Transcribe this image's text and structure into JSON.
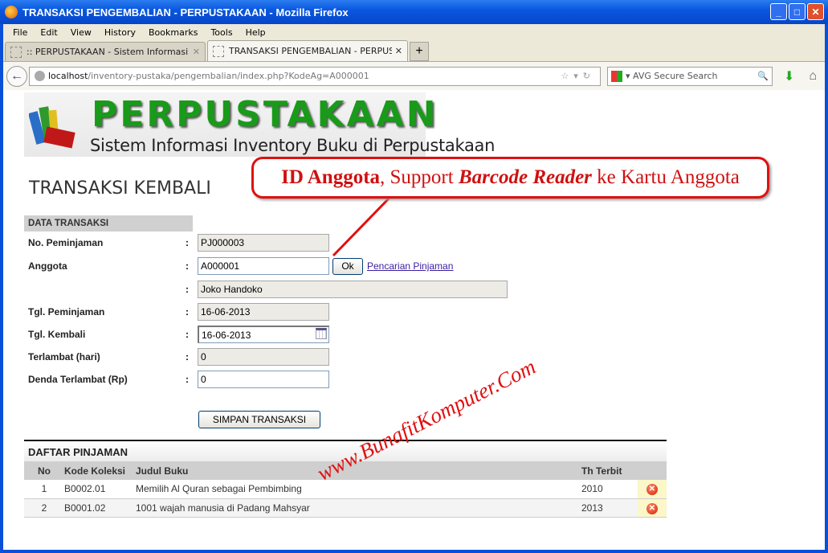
{
  "window": {
    "title": "TRANSAKSI PENGEMBALIAN - PERPUSTAKAAN - Mozilla Firefox"
  },
  "menu": [
    "File",
    "Edit",
    "View",
    "History",
    "Bookmarks",
    "Tools",
    "Help"
  ],
  "tabs": [
    {
      "label": ":: PERPUSTAKAAN - Sistem Informasi Inv..."
    },
    {
      "label": "TRANSAKSI PENGEMBALIAN - PERPUSTA..."
    }
  ],
  "url": {
    "host": "localhost",
    "path": "/inventory-pustaka/pengembalian/index.php?KodeAg=A000001"
  },
  "search": {
    "placeholder": "AVG Secure Search"
  },
  "logo": {
    "title": "PERPUSTAKAAN",
    "subtitle": "Sistem Informasi Inventory Buku di Perpustakaan"
  },
  "page_title": "TRANSAKSI KEMBALI",
  "callout": {
    "bold": "ID Anggota",
    "mid": ", Support ",
    "italic": "Barcode Reader",
    "end": " ke Kartu Anggota"
  },
  "form": {
    "section": "DATA TRANSAKSI",
    "colon": ":",
    "no_peminjaman": {
      "label": "No. Peminjaman",
      "value": "PJ000003"
    },
    "anggota": {
      "label": "Anggota",
      "value": "A000001",
      "ok": "Ok",
      "link": "Pencarian Pinjaman",
      "name": "Joko Handoko"
    },
    "tgl_peminjaman": {
      "label": "Tgl. Peminjaman",
      "value": "16-06-2013"
    },
    "tgl_kembali": {
      "label": "Tgl. Kembali",
      "value": "16-06-2013"
    },
    "terlambat": {
      "label": "Terlambat (hari)",
      "value": "0"
    },
    "denda": {
      "label": "Denda Terlambat (Rp)",
      "value": "0"
    },
    "save": "SIMPAN TRANSAKSI"
  },
  "table": {
    "title": "DAFTAR PINJAMAN",
    "headers": [
      "No",
      "Kode Koleksi",
      "Judul Buku",
      "Th Terbit"
    ],
    "rows": [
      {
        "no": "1",
        "kode": "B0002.01",
        "judul": "Memilih Al Quran sebagai Pembimbing",
        "tahun": "2010"
      },
      {
        "no": "2",
        "kode": "B0001.02",
        "judul": "1001 wajah manusia di Padang Mahsyar",
        "tahun": "2013"
      }
    ]
  },
  "watermark": "www.BunafitKomputer.Com"
}
